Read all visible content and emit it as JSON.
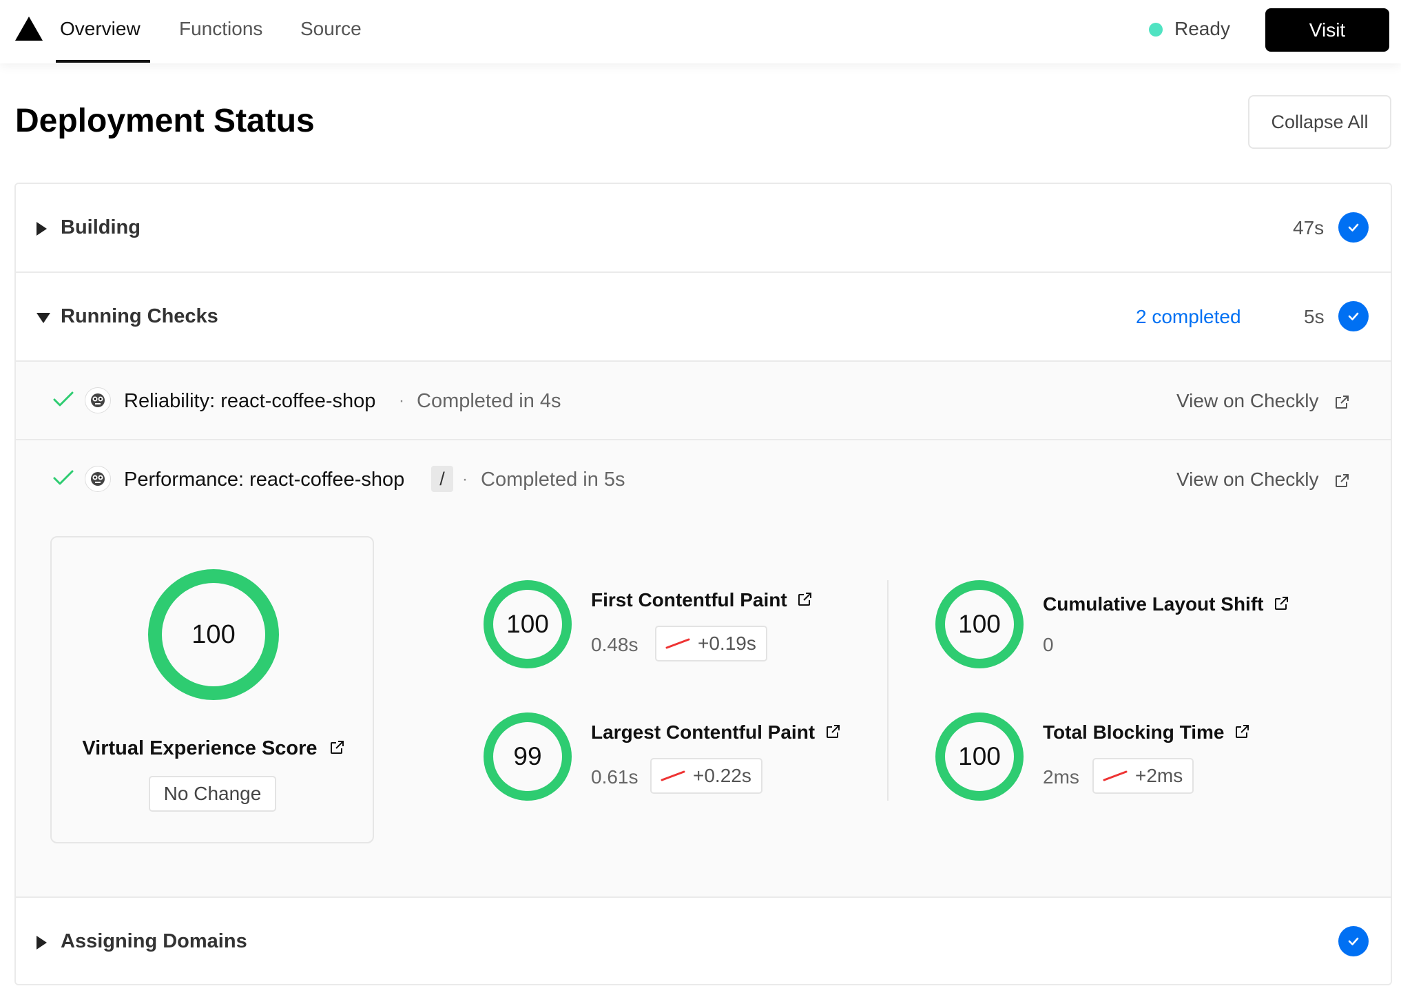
{
  "nav": {
    "tabs": [
      {
        "label": "Overview",
        "active": true
      },
      {
        "label": "Functions",
        "active": false
      },
      {
        "label": "Source",
        "active": false
      }
    ],
    "status": {
      "label": "Ready",
      "color": "#50e3c2"
    },
    "visit_label": "Visit"
  },
  "header": {
    "title": "Deployment Status",
    "collapse_label": "Collapse All"
  },
  "sections": {
    "building": {
      "title": "Building",
      "duration": "47s"
    },
    "running": {
      "title": "Running Checks",
      "completed": "2 completed",
      "duration": "5s"
    },
    "domains": {
      "title": "Assigning Domains"
    }
  },
  "checks": {
    "reliability": {
      "name": "Reliability: react-coffee-shop",
      "time": "Completed in 4s",
      "link": "View on Checkly"
    },
    "performance": {
      "name": "Performance: react-coffee-shop",
      "path": "/",
      "time": "Completed in 5s",
      "link": "View on Checkly"
    }
  },
  "vex": {
    "score": "100",
    "title": "Virtual Experience Score",
    "change": "No Change"
  },
  "metrics": {
    "fcp": {
      "score": "100",
      "title": "First Contentful Paint",
      "value": "0.48s",
      "delta": "+0.19s"
    },
    "lcp": {
      "score": "99",
      "title": "Largest Contentful Paint",
      "value": "0.61s",
      "delta": "+0.22s"
    },
    "cls": {
      "score": "100",
      "title": "Cumulative Layout Shift",
      "value": "0"
    },
    "tbt": {
      "score": "100",
      "title": "Total Blocking Time",
      "value": "2ms",
      "delta": "+2ms"
    }
  },
  "colors": {
    "accent": "#0070f3",
    "score_green": "#2ecc71",
    "trend_red": "#ee3333",
    "check_green": "#2ecc71"
  }
}
